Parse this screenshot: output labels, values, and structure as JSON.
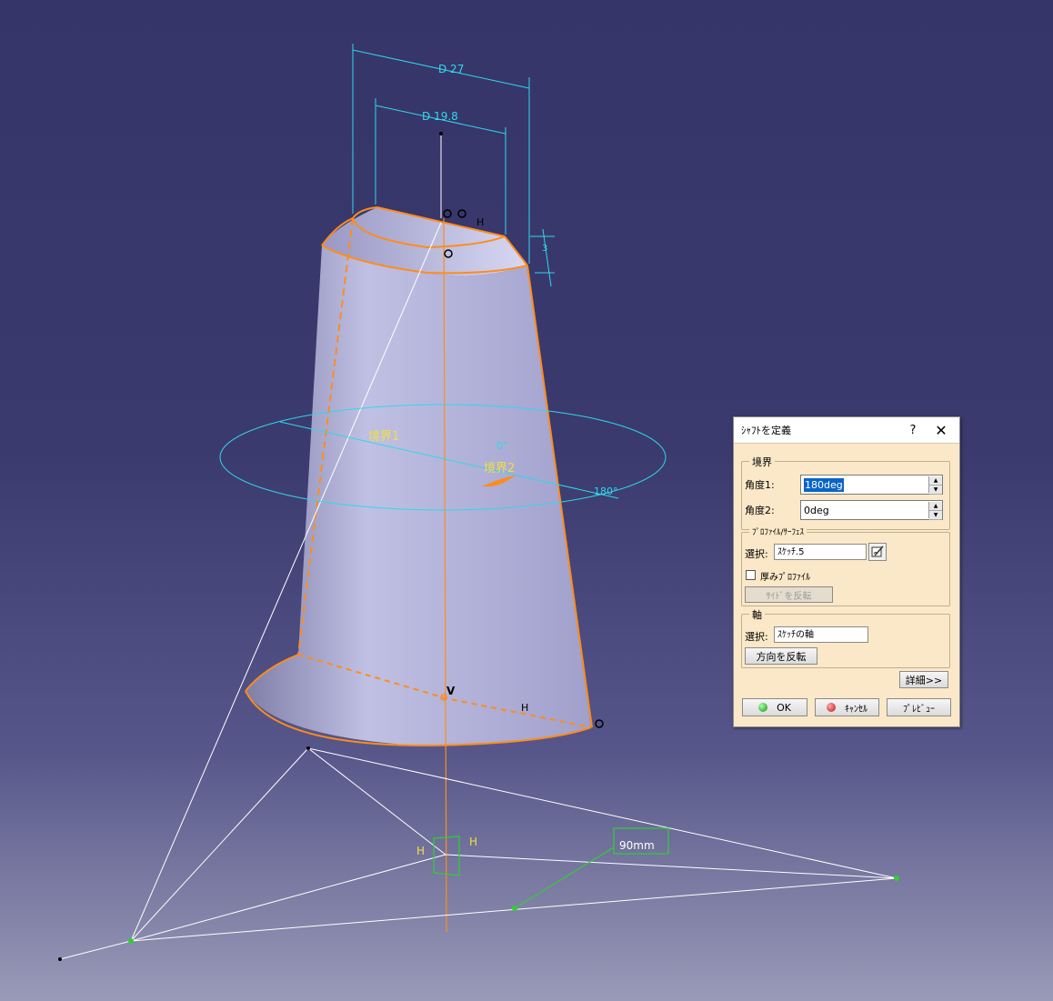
{
  "viewport": {
    "dimensions": {
      "outer_diameter": "D 27",
      "inner_diameter": "D 19.8",
      "height_dim": "3"
    },
    "boundaries": {
      "boundary1": "境界1",
      "boundary2": "境界2",
      "angle_small": "0°",
      "angle_large": "180°"
    },
    "sketch": {
      "dimension_90": "90mm"
    },
    "constraints": {
      "h": "H",
      "v": "V"
    }
  },
  "dialog": {
    "title": "ｼｬﾌﾄを定義",
    "help_label": "?",
    "close_label": "✕",
    "limits": {
      "group_label": "境界",
      "angle1_label": "角度1:",
      "angle1_value": "180deg",
      "angle2_label": "角度2:",
      "angle2_value": "0deg"
    },
    "profile": {
      "group_label": "ﾌﾟﾛﾌｧｲﾙ/ｻｰﾌｪｽ",
      "selection_label": "選択:",
      "selection_value": "ｽｹｯﾁ.5",
      "thick_label": "厚みﾌﾟﾛﾌｧｲﾙ",
      "reverse_side_label": "ｻｲﾄﾞを反転"
    },
    "axis": {
      "group_label": "軸",
      "selection_label": "選択:",
      "selection_value": "ｽｹｯﾁの軸",
      "reverse_direction_label": "方向を反転"
    },
    "more_label": "詳細>>",
    "ok_label": "OK",
    "cancel_label": "ｷｬﾝｾﾙ",
    "preview_label": "ﾌﾟﾚﾋﾞｭｰ"
  },
  "colors": {
    "accent_orange": "#ff8c1a",
    "cyan": "#33d6e8",
    "body": "#b6b6d8",
    "sketch_green": "#2fd02f"
  }
}
